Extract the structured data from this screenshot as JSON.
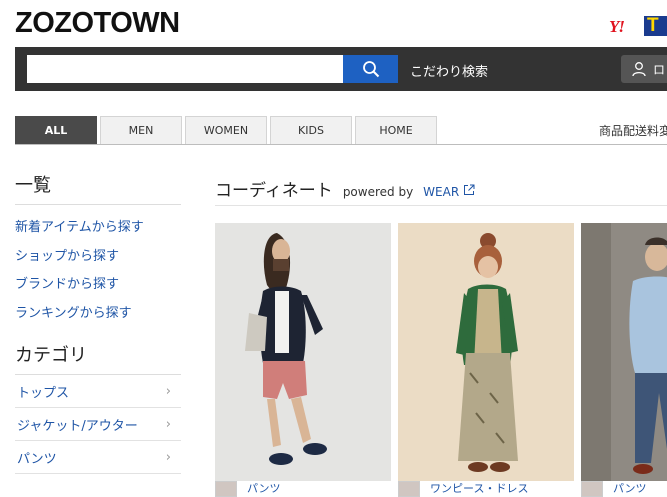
{
  "header": {
    "logo": "ZOZOTOWN",
    "yahoo_logo": "Y!",
    "tpoint_logo": "T"
  },
  "search": {
    "value": "",
    "placeholder": "",
    "advanced_label": "こだわり検索",
    "login_label": "ロ"
  },
  "tabs": [
    {
      "label": "ALL",
      "active": true
    },
    {
      "label": "MEN",
      "active": false
    },
    {
      "label": "WOMEN",
      "active": false
    },
    {
      "label": "KIDS",
      "active": false
    },
    {
      "label": "HOME",
      "active": false
    }
  ],
  "shipping_text": "商品配送料変",
  "sidebar": {
    "list_heading": "一覧",
    "links": [
      "新着アイテムから探す",
      "ショップから探す",
      "ブランドから探す",
      "ランキングから探す"
    ],
    "category_heading": "カテゴリ",
    "categories": [
      "トップス",
      "ジャケット/アウター",
      "パンツ"
    ]
  },
  "main": {
    "title": "コーディネート",
    "powered_by": "powered by",
    "wear": "WEAR"
  },
  "cards": [
    {
      "tag": "パンツ"
    },
    {
      "tag": "ワンピース・ドレス"
    },
    {
      "tag": "パンツ"
    }
  ],
  "colors": {
    "accent_blue": "#1e61c2",
    "link_blue": "#1f55a6",
    "header_bar": "#333333",
    "tab_active": "#4a4a4a",
    "yahoo_red": "#e0121e"
  }
}
